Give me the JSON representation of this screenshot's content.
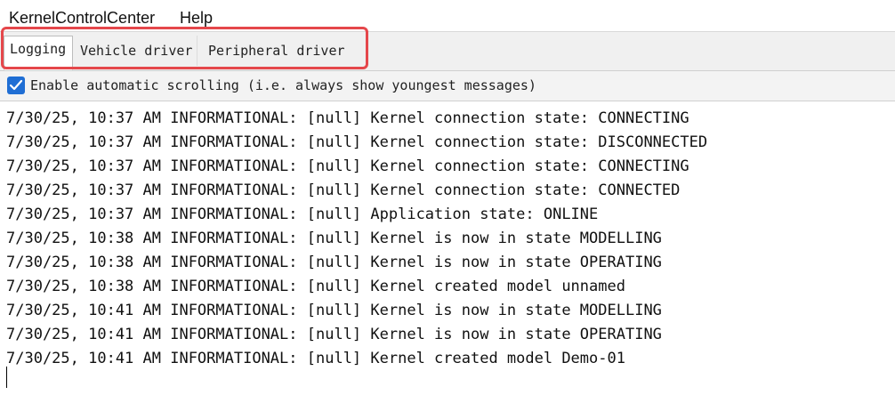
{
  "menubar": {
    "items": [
      "KernelControlCenter",
      "Help"
    ]
  },
  "tabs": [
    {
      "label": "Logging",
      "selected": true
    },
    {
      "label": "Vehicle driver",
      "selected": false
    },
    {
      "label": "Peripheral driver",
      "selected": false
    }
  ],
  "options": {
    "auto_scroll_checked": true,
    "auto_scroll_label": "Enable automatic scrolling (i.e. always show youngest messages)"
  },
  "colors": {
    "highlight": "#e5474b",
    "checkbox": "#1f6ed4"
  },
  "log": {
    "lines": [
      "7/30/25, 10:37 AM INFORMATIONAL: [null] Kernel connection state: CONNECTING",
      "7/30/25, 10:37 AM INFORMATIONAL: [null] Kernel connection state: DISCONNECTED",
      "7/30/25, 10:37 AM INFORMATIONAL: [null] Kernel connection state: CONNECTING",
      "7/30/25, 10:37 AM INFORMATIONAL: [null] Kernel connection state: CONNECTED",
      "7/30/25, 10:37 AM INFORMATIONAL: [null] Application state: ONLINE",
      "7/30/25, 10:38 AM INFORMATIONAL: [null] Kernel is now in state MODELLING",
      "7/30/25, 10:38 AM INFORMATIONAL: [null] Kernel is now in state OPERATING",
      "7/30/25, 10:38 AM INFORMATIONAL: [null] Kernel created model unnamed",
      "7/30/25, 10:41 AM INFORMATIONAL: [null] Kernel is now in state MODELLING",
      "7/30/25, 10:41 AM INFORMATIONAL: [null] Kernel is now in state OPERATING",
      "7/30/25, 10:41 AM INFORMATIONAL: [null] Kernel created model Demo-01"
    ]
  }
}
